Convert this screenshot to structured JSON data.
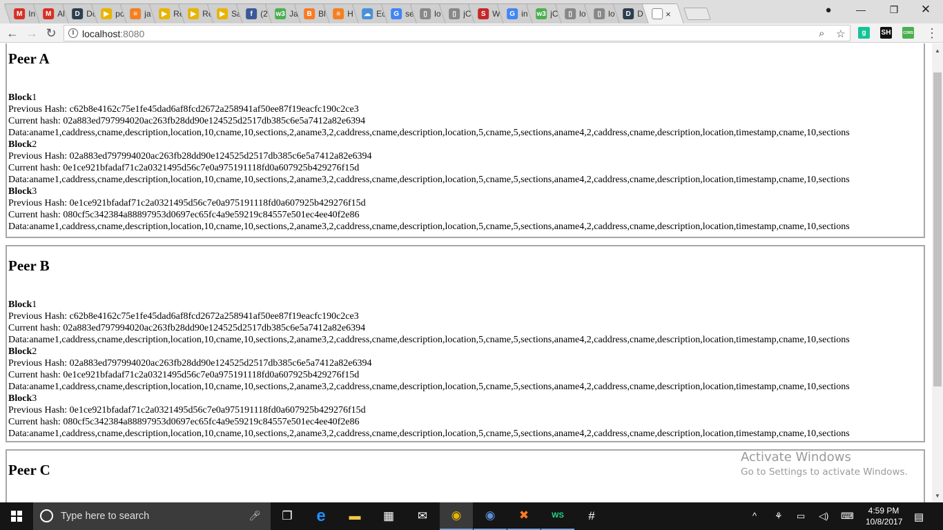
{
  "browser": {
    "tabs": [
      {
        "label": "In",
        "icon": "gmail-icon",
        "glyph": "M",
        "color": "#d93025"
      },
      {
        "label": "Al",
        "icon": "gmail-icon",
        "glyph": "M",
        "color": "#d93025"
      },
      {
        "label": "Dc",
        "icon": "d-logo-icon",
        "glyph": "D",
        "color": "#2c3e50"
      },
      {
        "label": "pc",
        "icon": "folder-icon",
        "glyph": "▶",
        "color": "#e8b400"
      },
      {
        "label": "ja",
        "icon": "stack-icon",
        "glyph": "≡",
        "color": "#f48024"
      },
      {
        "label": "Re",
        "icon": "folder-icon",
        "glyph": "▶",
        "color": "#e8b400"
      },
      {
        "label": "Re",
        "icon": "folder-icon",
        "glyph": "▶",
        "color": "#e8b400"
      },
      {
        "label": "Sa",
        "icon": "folder-icon",
        "glyph": "▶",
        "color": "#e8b400"
      },
      {
        "label": "(2",
        "icon": "facebook-icon",
        "glyph": "f",
        "color": "#3b5998"
      },
      {
        "label": "Ja",
        "icon": "w3schools-icon",
        "glyph": "w3",
        "color": "#4caf50"
      },
      {
        "label": "Bl",
        "icon": "xampp-icon",
        "glyph": "B",
        "color": "#fb7a24"
      },
      {
        "label": "H",
        "icon": "stack-icon",
        "glyph": "≡",
        "color": "#f48024"
      },
      {
        "label": "Ec",
        "icon": "cloud-icon",
        "glyph": "☁",
        "color": "#4a90d9"
      },
      {
        "label": "se",
        "icon": "google-icon",
        "glyph": "G",
        "color": "#4285f4"
      },
      {
        "label": "lo",
        "icon": "page-icon",
        "glyph": "▯",
        "color": "#888888"
      },
      {
        "label": "jC",
        "icon": "page-icon",
        "glyph": "▯",
        "color": "#888888"
      },
      {
        "label": "W",
        "icon": "layers-icon",
        "glyph": "S",
        "color": "#c62828"
      },
      {
        "label": "in",
        "icon": "google-icon",
        "glyph": "G",
        "color": "#4285f4"
      },
      {
        "label": "jC",
        "icon": "w3schools-icon",
        "glyph": "w3",
        "color": "#4caf50"
      },
      {
        "label": "lo",
        "icon": "page-icon",
        "glyph": "▯",
        "color": "#888888"
      },
      {
        "label": "lo",
        "icon": "page-icon",
        "glyph": "▯",
        "color": "#888888"
      },
      {
        "label": "D",
        "icon": "d-logo-icon",
        "glyph": "D",
        "color": "#2c3e50"
      }
    ],
    "active_tab": {
      "icon": "page-icon",
      "close": "×"
    },
    "url_host": "localhost",
    "url_port": ":8080",
    "extensions": [
      {
        "icon": "grammarly-icon",
        "glyph": "g",
        "color": "#15c39a"
      },
      {
        "icon": "sh-extension-icon",
        "glyph": "SH",
        "color": "#111111"
      },
      {
        "icon": "cors-extension-icon",
        "glyph": "CORS",
        "color": "#4caf50"
      }
    ],
    "menu_glyph": "⋮"
  },
  "blocks_template": {
    "block_label": "Block",
    "prev_label": "Previous Hash: ",
    "curr_label": "Current hash: ",
    "data_label": "Data:"
  },
  "peers": [
    {
      "title": "Peer A",
      "blocks": [
        {
          "num": "1",
          "prev": "c62b8e4162c75e1fe45dad6af8fcd2672a258941af50ee87f19eacfc190c2ce3",
          "curr": "02a883ed797994020ac263fb28dd90e124525d2517db385c6e5a7412a82e6394",
          "data": "aname1,caddress,cname,description,location,10,cname,10,sections,2,aname3,2,caddress,cname,description,location,5,cname,5,sections,aname4,2,caddress,cname,description,location,timestamp,cname,10,sections"
        },
        {
          "num": "2",
          "prev": "02a883ed797994020ac263fb28dd90e124525d2517db385c6e5a7412a82e6394",
          "curr": "0e1ce921bfadaf71c2a0321495d56c7e0a975191118fd0a607925b429276f15d",
          "data": "aname1,caddress,cname,description,location,10,cname,10,sections,2,aname3,2,caddress,cname,description,location,5,cname,5,sections,aname4,2,caddress,cname,description,location,timestamp,cname,10,sections"
        },
        {
          "num": "3",
          "prev": "0e1ce921bfadaf71c2a0321495d56c7e0a975191118fd0a607925b429276f15d",
          "curr": "080cf5c342384a88897953d0697ec65fc4a9e59219c84557e501ec4ee40f2e86",
          "data": "aname1,caddress,cname,description,location,10,cname,10,sections,2,aname3,2,caddress,cname,description,location,5,cname,5,sections,aname4,2,caddress,cname,description,location,timestamp,cname,10,sections"
        }
      ]
    },
    {
      "title": "Peer B",
      "blocks": [
        {
          "num": "1",
          "prev": "c62b8e4162c75e1fe45dad6af8fcd2672a258941af50ee87f19eacfc190c2ce3",
          "curr": "02a883ed797994020ac263fb28dd90e124525d2517db385c6e5a7412a82e6394",
          "data": "aname1,caddress,cname,description,location,10,cname,10,sections,2,aname3,2,caddress,cname,description,location,5,cname,5,sections,aname4,2,caddress,cname,description,location,timestamp,cname,10,sections"
        },
        {
          "num": "2",
          "prev": "02a883ed797994020ac263fb28dd90e124525d2517db385c6e5a7412a82e6394",
          "curr": "0e1ce921bfadaf71c2a0321495d56c7e0a975191118fd0a607925b429276f15d",
          "data": "aname1,caddress,cname,description,location,10,cname,10,sections,2,aname3,2,caddress,cname,description,location,5,cname,5,sections,aname4,2,caddress,cname,description,location,timestamp,cname,10,sections"
        },
        {
          "num": "3",
          "prev": "0e1ce921bfadaf71c2a0321495d56c7e0a975191118fd0a607925b429276f15d",
          "curr": "080cf5c342384a88897953d0697ec65fc4a9e59219c84557e501ec4ee40f2e86",
          "data": "aname1,caddress,cname,description,location,10,cname,10,sections,2,aname3,2,caddress,cname,description,location,5,cname,5,sections,aname4,2,caddress,cname,description,location,timestamp,cname,10,sections"
        }
      ]
    },
    {
      "title": "Peer C",
      "blocks": []
    }
  ],
  "watermark": {
    "line1": "Activate Windows",
    "line2": "Go to Settings to activate Windows."
  },
  "taskbar": {
    "search_placeholder": "Type here to search",
    "apps": [
      {
        "name": "task-view-icon",
        "glyph": "❐",
        "color": "#ffffff",
        "state": ""
      },
      {
        "name": "edge-icon",
        "glyph": "e",
        "color": "#1e90ff",
        "state": ""
      },
      {
        "name": "file-explorer-icon",
        "glyph": "▬",
        "color": "#f2c744",
        "state": ""
      },
      {
        "name": "store-icon",
        "glyph": "▦",
        "color": "#ffffff",
        "state": ""
      },
      {
        "name": "mail-icon",
        "glyph": "✉",
        "color": "#ffffff",
        "state": ""
      },
      {
        "name": "chrome-icon",
        "glyph": "◉",
        "color": "#e8b400",
        "state": "active"
      },
      {
        "name": "chrome-canary-icon",
        "glyph": "◉",
        "color": "#5b8fd6",
        "state": "running"
      },
      {
        "name": "xampp-icon",
        "glyph": "✖",
        "color": "#fb7a24",
        "state": "running"
      },
      {
        "name": "webstorm-icon",
        "glyph": "WS",
        "color": "#21d789",
        "state": "running"
      },
      {
        "name": "slack-icon",
        "glyph": "#",
        "color": "#ffffff",
        "state": ""
      }
    ],
    "tray_glyphs": [
      "^",
      "⚘",
      "▭",
      "◁)",
      "⌨"
    ],
    "time": "4:59 PM",
    "date": "10/8/2017",
    "notification_glyph": "▤"
  }
}
